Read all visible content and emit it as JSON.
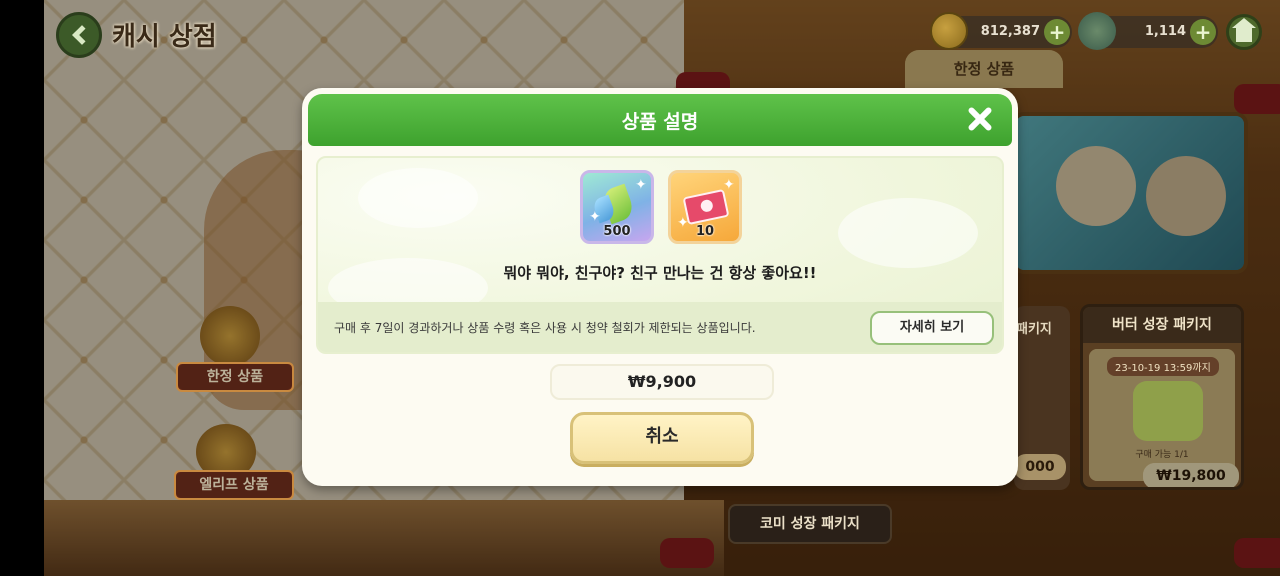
{
  "header": {
    "title": "캐시 상점",
    "coins": "812,387",
    "crystals": "1,114"
  },
  "tabs": {
    "limited": "한정 상품"
  },
  "shelf": {
    "limited_label": "한정 상품",
    "relief_label": "엘리프 상품"
  },
  "packages": {
    "butter": {
      "title": "버터 성장 패키지",
      "timer": "23-10-19 13:59까지",
      "limit": "구매 가능 1/1",
      "price": "₩19,800"
    },
    "partial_title": "패키지",
    "partial_price": "000",
    "comi": "코미 성장 패키지"
  },
  "modal": {
    "title": "상품 설명",
    "items": [
      {
        "name": "leaf-item",
        "qty": "500"
      },
      {
        "name": "ticket-item",
        "qty": "10"
      }
    ],
    "dialog": "뭐야 뭐야, 친구야? 친구 만나는 건 항상 좋아요!!",
    "notice": "구매 후 7일이 경과하거나 상품 수령 혹은 사용 시 청약 철회가 제한되는 상품입니다.",
    "details_button": "자세히 보기",
    "price": "₩9,900",
    "cancel_button": "취소"
  },
  "colors": {
    "modal_header": "#4bb23a",
    "cancel_button": "#fbecb8",
    "details_border": "#97c07a"
  },
  "icons": [
    "back-arrow-icon",
    "coin-icon",
    "leaf-crystal-icon",
    "plus-icon",
    "home-icon",
    "close-icon"
  ]
}
